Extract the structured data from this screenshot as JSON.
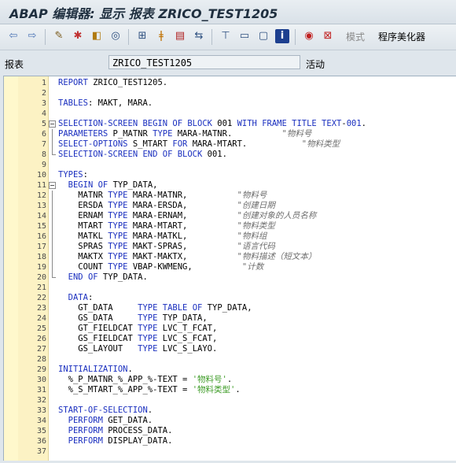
{
  "window": {
    "title": "ABAP 编辑器: 显示 报表 ZRICO_TEST1205"
  },
  "toolbar": {
    "pattern_label": "模式",
    "pretty_printer_label": "程序美化器"
  },
  "header": {
    "report_label": "报表",
    "program_name": "ZRICO_TEST1205",
    "status": "活动"
  },
  "colors": {
    "keyword": "#1a2fbf",
    "comment": "#6e6e6e",
    "string": "#3f9c28",
    "gutter": "#fcf2c4"
  },
  "editor": {
    "lines": [
      {
        "n": "1",
        "fold": "",
        "parts": [
          [
            "kw",
            "REPORT "
          ],
          [
            "",
            "ZRICO_TEST1205."
          ]
        ]
      },
      {
        "n": "2",
        "fold": "",
        "parts": []
      },
      {
        "n": "3",
        "fold": "",
        "parts": [
          [
            "kw",
            "TABLES"
          ],
          [
            "",
            ": MAKT, MARA."
          ]
        ]
      },
      {
        "n": "4",
        "fold": "",
        "parts": []
      },
      {
        "n": "5",
        "fold": "box",
        "parts": [
          [
            "kw",
            "SELECTION-SCREEN BEGIN OF BLOCK "
          ],
          [
            "",
            "001 "
          ],
          [
            "kw",
            "WITH FRAME TITLE TEXT"
          ],
          [
            "",
            "-"
          ],
          [
            "kw",
            "001"
          ],
          [
            "",
            "."
          ]
        ]
      },
      {
        "n": "6",
        "fold": "vline",
        "parts": [
          [
            "kw",
            "PARAMETERS "
          ],
          [
            "",
            "P_MATNR "
          ],
          [
            "kw",
            "TYPE "
          ],
          [
            "",
            "MARA-MATNR.          "
          ],
          [
            "cm",
            "\"物料号"
          ]
        ]
      },
      {
        "n": "7",
        "fold": "vline",
        "parts": [
          [
            "kw",
            "SELECT-OPTIONS "
          ],
          [
            "",
            "S_MTART "
          ],
          [
            "kw",
            "FOR "
          ],
          [
            "",
            "MARA-MTART.           "
          ],
          [
            "cm",
            "\"物料类型"
          ]
        ]
      },
      {
        "n": "8",
        "fold": "end",
        "parts": [
          [
            "kw",
            "SELECTION-SCREEN END OF BLOCK "
          ],
          [
            "",
            "001."
          ]
        ]
      },
      {
        "n": "9",
        "fold": "",
        "parts": []
      },
      {
        "n": "10",
        "fold": "",
        "parts": [
          [
            "kw",
            "TYPES"
          ],
          [
            "",
            ":"
          ]
        ]
      },
      {
        "n": "11",
        "fold": "box",
        "parts": [
          [
            "",
            "  "
          ],
          [
            "kw",
            "BEGIN OF "
          ],
          [
            "",
            "TYP_DATA,"
          ]
        ]
      },
      {
        "n": "12",
        "fold": "vline",
        "parts": [
          [
            "",
            "    MATNR "
          ],
          [
            "kw",
            "TYPE "
          ],
          [
            "",
            "MARA-MATNR,          "
          ],
          [
            "cm",
            "\"物料号"
          ]
        ]
      },
      {
        "n": "13",
        "fold": "vline",
        "parts": [
          [
            "",
            "    ERSDA "
          ],
          [
            "kw",
            "TYPE "
          ],
          [
            "",
            "MARA-ERSDA,          "
          ],
          [
            "cm",
            "\"创建日期"
          ]
        ]
      },
      {
        "n": "14",
        "fold": "vline",
        "parts": [
          [
            "",
            "    ERNAM "
          ],
          [
            "kw",
            "TYPE "
          ],
          [
            "",
            "MARA-ERNAM,          "
          ],
          [
            "cm",
            "\"创建对象的人员名称"
          ]
        ]
      },
      {
        "n": "15",
        "fold": "vline",
        "parts": [
          [
            "",
            "    MTART "
          ],
          [
            "kw",
            "TYPE "
          ],
          [
            "",
            "MARA-MTART,          "
          ],
          [
            "cm",
            "\"物料类型"
          ]
        ]
      },
      {
        "n": "16",
        "fold": "vline",
        "parts": [
          [
            "",
            "    MATKL "
          ],
          [
            "kw",
            "TYPE "
          ],
          [
            "",
            "MARA-MATKL,          "
          ],
          [
            "cm",
            "\"物料组"
          ]
        ]
      },
      {
        "n": "17",
        "fold": "vline",
        "parts": [
          [
            "",
            "    SPRAS "
          ],
          [
            "kw",
            "TYPE "
          ],
          [
            "",
            "MAKT-SPRAS,          "
          ],
          [
            "cm",
            "\"语言代码"
          ]
        ]
      },
      {
        "n": "18",
        "fold": "vline",
        "parts": [
          [
            "",
            "    MAKTX "
          ],
          [
            "kw",
            "TYPE "
          ],
          [
            "",
            "MAKT-MAKTX,          "
          ],
          [
            "cm",
            "\"物料描述（短文本）"
          ]
        ]
      },
      {
        "n": "19",
        "fold": "vline",
        "parts": [
          [
            "",
            "    COUNT "
          ],
          [
            "kw",
            "TYPE "
          ],
          [
            "",
            "VBAP-KWMENG,          "
          ],
          [
            "cm",
            "\"计数"
          ]
        ]
      },
      {
        "n": "20",
        "fold": "end",
        "parts": [
          [
            "",
            "  "
          ],
          [
            "kw",
            "END OF "
          ],
          [
            "",
            "TYP_DATA."
          ]
        ]
      },
      {
        "n": "21",
        "fold": "",
        "parts": []
      },
      {
        "n": "22",
        "fold": "",
        "parts": [
          [
            "",
            "  "
          ],
          [
            "kw",
            "DATA"
          ],
          [
            "",
            ":"
          ]
        ]
      },
      {
        "n": "23",
        "fold": "",
        "parts": [
          [
            "",
            "    GT_DATA     "
          ],
          [
            "kw",
            "TYPE TABLE OF "
          ],
          [
            "",
            "TYP_DATA,"
          ]
        ]
      },
      {
        "n": "24",
        "fold": "",
        "parts": [
          [
            "",
            "    GS_DATA     "
          ],
          [
            "kw",
            "TYPE "
          ],
          [
            "",
            "TYP_DATA,"
          ]
        ]
      },
      {
        "n": "25",
        "fold": "",
        "parts": [
          [
            "",
            "    GT_FIELDCAT "
          ],
          [
            "kw",
            "TYPE "
          ],
          [
            "",
            "LVC_T_FCAT,"
          ]
        ]
      },
      {
        "n": "26",
        "fold": "",
        "parts": [
          [
            "",
            "    GS_FIELDCAT "
          ],
          [
            "kw",
            "TYPE "
          ],
          [
            "",
            "LVC_S_FCAT,"
          ]
        ]
      },
      {
        "n": "27",
        "fold": "",
        "parts": [
          [
            "",
            "    GS_LAYOUT   "
          ],
          [
            "kw",
            "TYPE "
          ],
          [
            "",
            "LVC_S_LAYO."
          ]
        ]
      },
      {
        "n": "28",
        "fold": "",
        "parts": []
      },
      {
        "n": "29",
        "fold": "",
        "parts": [
          [
            "kw",
            "INITIALIZATION"
          ],
          [
            "",
            "."
          ]
        ]
      },
      {
        "n": "30",
        "fold": "",
        "parts": [
          [
            "",
            "  %_P_MATNR_%_APP_%-TEXT = "
          ],
          [
            "st",
            "'物料号'"
          ],
          [
            "",
            "."
          ]
        ]
      },
      {
        "n": "31",
        "fold": "",
        "parts": [
          [
            "",
            "  %_S_MTART_%_APP_%-TEXT = "
          ],
          [
            "st",
            "'物料类型'"
          ],
          [
            "",
            "."
          ]
        ]
      },
      {
        "n": "32",
        "fold": "",
        "parts": []
      },
      {
        "n": "33",
        "fold": "",
        "parts": [
          [
            "kw",
            "START-OF-SELECTION"
          ],
          [
            "",
            "."
          ]
        ]
      },
      {
        "n": "34",
        "fold": "",
        "parts": [
          [
            "",
            "  "
          ],
          [
            "kw",
            "PERFORM "
          ],
          [
            "",
            "GET_DATA."
          ]
        ]
      },
      {
        "n": "35",
        "fold": "",
        "parts": [
          [
            "",
            "  "
          ],
          [
            "kw",
            "PERFORM "
          ],
          [
            "",
            "PROCESS_DATA."
          ]
        ]
      },
      {
        "n": "36",
        "fold": "",
        "parts": [
          [
            "",
            "  "
          ],
          [
            "kw",
            "PERFORM "
          ],
          [
            "",
            "DISPLAY_DATA."
          ]
        ]
      },
      {
        "n": "37",
        "fold": "",
        "parts": []
      }
    ]
  }
}
